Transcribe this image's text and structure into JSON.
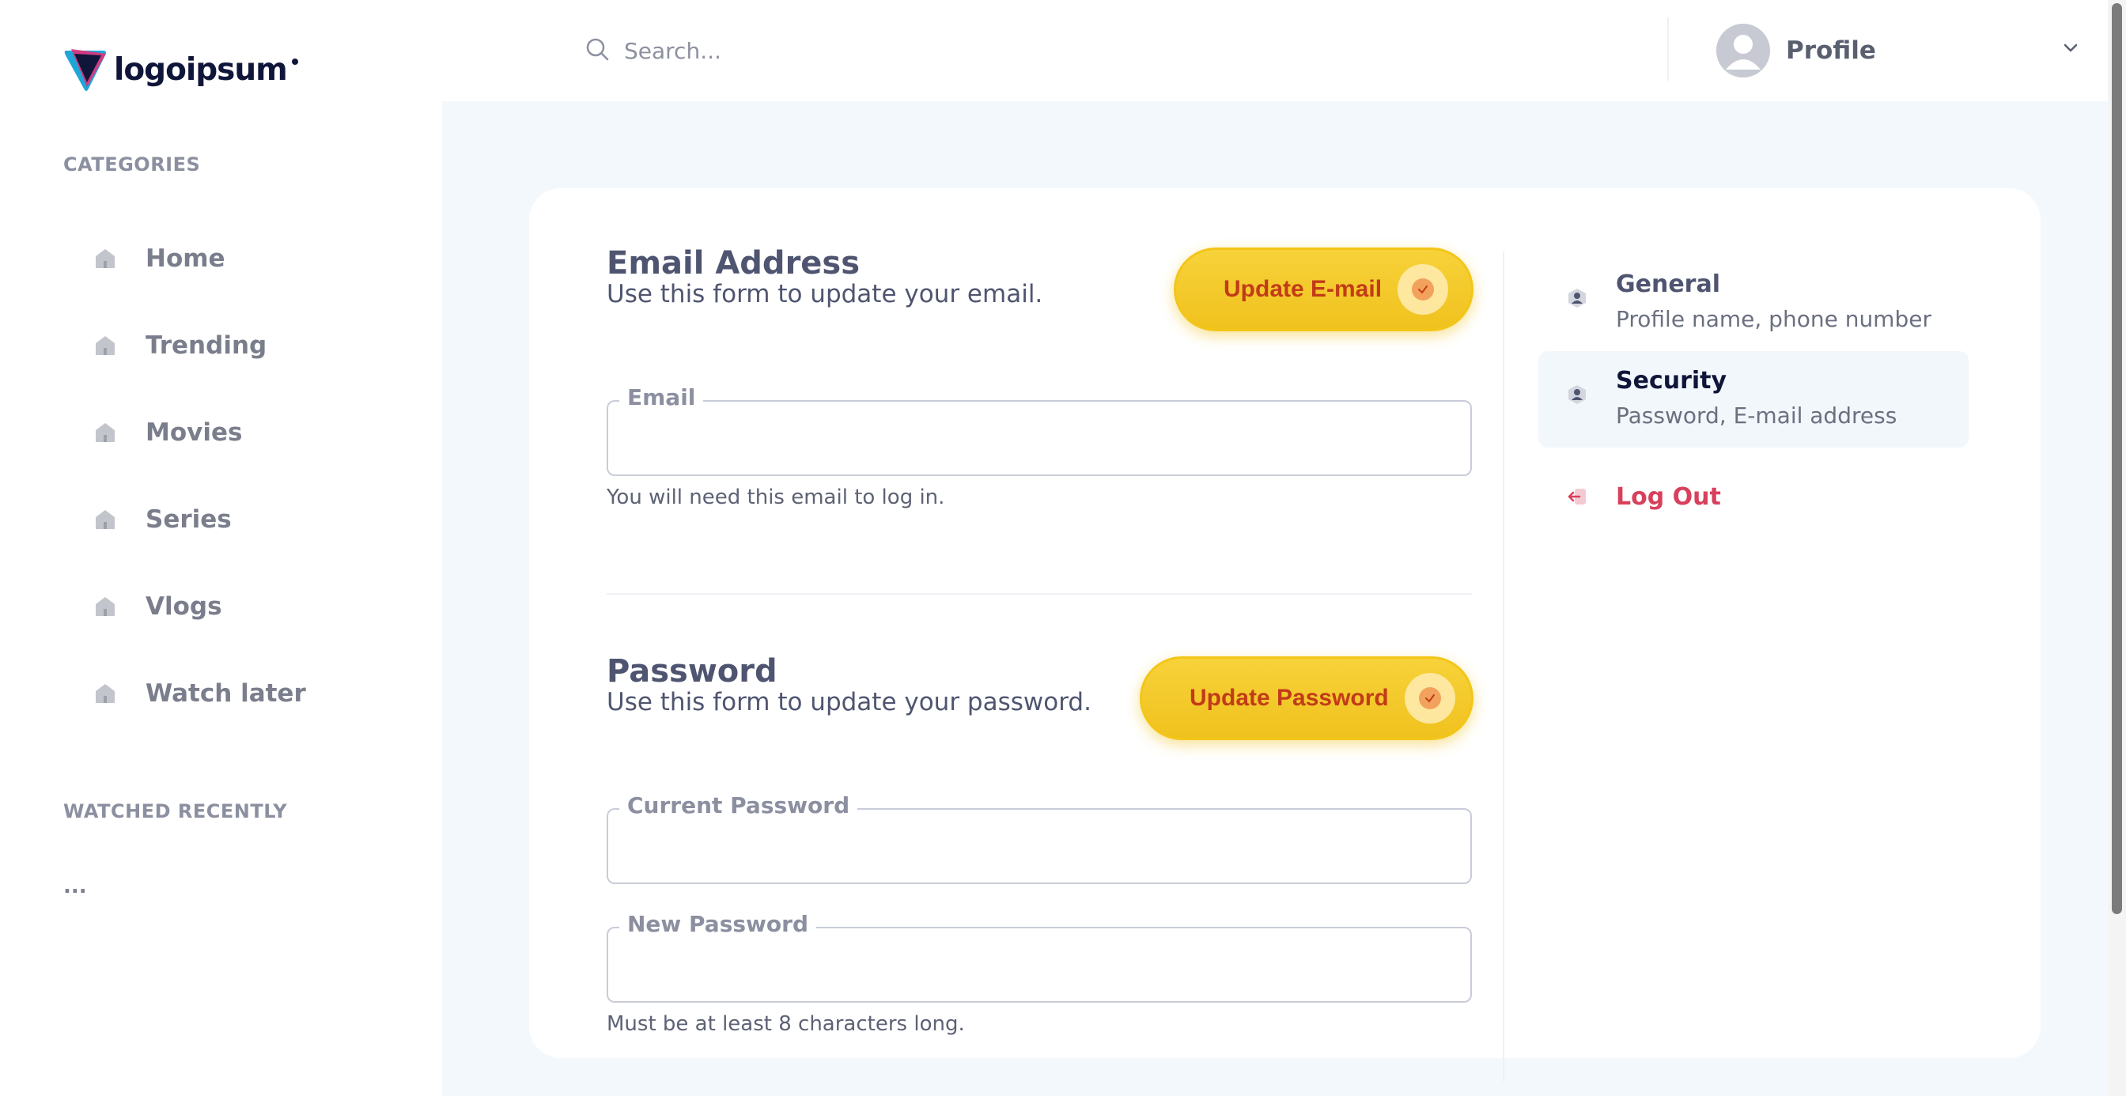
{
  "brand": {
    "logo_text": "logoipsum"
  },
  "sidebar": {
    "categories_title": "CATEGORIES",
    "items": [
      {
        "label": "Home",
        "icon": "home-icon"
      },
      {
        "label": "Trending",
        "icon": "home-icon"
      },
      {
        "label": "Movies",
        "icon": "home-icon"
      },
      {
        "label": "Series",
        "icon": "home-icon"
      },
      {
        "label": "Vlogs",
        "icon": "home-icon"
      },
      {
        "label": "Watch later",
        "icon": "home-icon"
      }
    ],
    "watched_title": "WATCHED RECENTLY",
    "watched_more": "..."
  },
  "header": {
    "search_placeholder": "Search...",
    "profile_label": "Profile"
  },
  "email_section": {
    "title": "Email Address",
    "subtitle": "Use this form to update your email.",
    "button_label": "Update E-mail",
    "field_label": "Email",
    "field_value": "",
    "hint": "You will need this email to log in."
  },
  "password_section": {
    "title": "Password",
    "subtitle": "Use this form to update your password.",
    "button_label": "Update Password",
    "current_label": "Current Password",
    "current_value": "",
    "new_label": "New Password",
    "new_value": "",
    "hint": "Must be at least 8 characters long."
  },
  "settings_nav": {
    "items": [
      {
        "title": "General",
        "subtitle": "Profile name, phone number",
        "active": false
      },
      {
        "title": "Security",
        "subtitle": "Password, E-mail address",
        "active": true
      }
    ],
    "logout_label": "Log Out"
  },
  "colors": {
    "accent_yellow": "#f4c519",
    "button_text": "#c23b18",
    "logout": "#d8405c",
    "main_bg": "#f3f8fc"
  }
}
